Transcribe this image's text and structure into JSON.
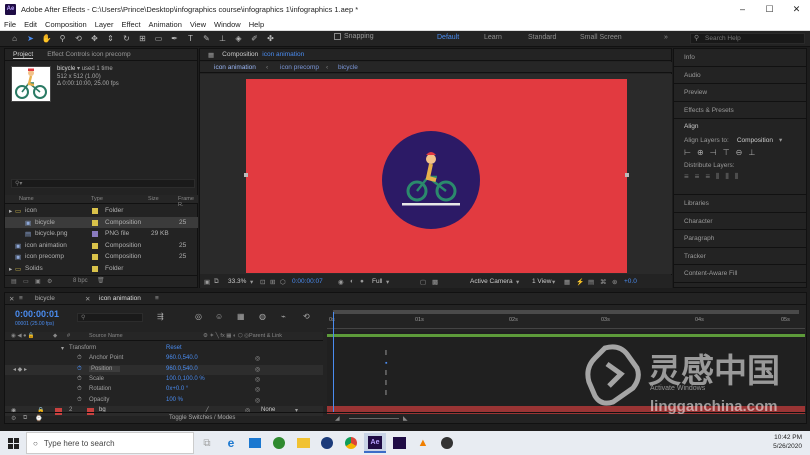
{
  "window": {
    "title": "Adobe After Effects - C:\\Users\\Prince\\Desktop\\infographics course\\infographics 1\\infographics 1.aep *",
    "app_abbr": "Ae"
  },
  "menu": [
    "File",
    "Edit",
    "Composition",
    "Layer",
    "Effect",
    "Animation",
    "View",
    "Window",
    "Help"
  ],
  "toolbar": {
    "snapping": "Snapping",
    "workspaces": [
      "Default",
      "Learn",
      "Standard",
      "Small Screen"
    ],
    "search_placeholder": "Search Help"
  },
  "project": {
    "tabs": [
      "Project",
      "Effect Controls icon precomp"
    ],
    "selected": {
      "name": "bicycle",
      "used": "used 1 time",
      "dims": "512 x 512 (1.00)",
      "duration": "Δ 0:00:10:00, 25.00 fps"
    },
    "columns": [
      "Name",
      "Type",
      "Size",
      "Frame R."
    ],
    "rows": [
      {
        "name": "icon",
        "type": "Folder",
        "size": "",
        "fr": "",
        "indent": 0,
        "color": "#d9c24a"
      },
      {
        "name": "bicycle",
        "type": "Composition",
        "size": "",
        "fr": "25",
        "indent": 1,
        "color": "#d9c24a"
      },
      {
        "name": "bicycle.png",
        "type": "PNG file",
        "size": "29 KB",
        "fr": "",
        "indent": 1,
        "color": "#8a7bbf"
      },
      {
        "name": "icon animation",
        "type": "Composition",
        "size": "",
        "fr": "25",
        "indent": 0,
        "color": "#d9c24a"
      },
      {
        "name": "icon precomp",
        "type": "Composition",
        "size": "",
        "fr": "25",
        "indent": 0,
        "color": "#d9c24a"
      },
      {
        "name": "Solids",
        "type": "Folder",
        "size": "",
        "fr": "",
        "indent": 0,
        "color": "#d9c24a"
      }
    ],
    "footer_bpc": "8 bpc"
  },
  "comp": {
    "tab": "Composition",
    "tab_name": "icon animation",
    "breadcrumbs": [
      "icon animation",
      "icon precomp",
      "bicycle"
    ],
    "zoom": "33.3%",
    "timecode": "0:00:00:07",
    "resolution": "Full",
    "camera": "Active Camera",
    "views": "1 View",
    "exposure": "+0.0"
  },
  "right_panel": {
    "items": [
      "Info",
      "Audio",
      "Preview",
      "Effects & Presets"
    ],
    "align_title": "Align",
    "align_layers_to": "Align Layers to:",
    "align_target": "Composition",
    "distribute": "Distribute Layers:",
    "items2": [
      "Libraries",
      "Character",
      "Paragraph",
      "Tracker",
      "Content-Aware Fill"
    ]
  },
  "timeline": {
    "tabs": [
      "bicycle",
      "icon animation"
    ],
    "timecode": "0:00:00:01",
    "timecode_sub": "00001 (25.00 fps)",
    "columns": [
      "Source Name",
      "Parent & Link"
    ],
    "ruler": [
      "0s",
      "01s",
      "02s",
      "03s",
      "04s",
      "05s"
    ],
    "rows": [
      {
        "label": "Transform",
        "value": "Reset",
        "indent": 1
      },
      {
        "label": "Anchor Point",
        "value": "960.0,540.0",
        "indent": 2
      },
      {
        "label": "Position",
        "value": "960.0,540.0",
        "indent": 2
      },
      {
        "label": "Scale",
        "value": "100.0,100.0 %",
        "indent": 2
      },
      {
        "label": "Rotation",
        "value": "0x+0.0 °",
        "indent": 2
      },
      {
        "label": "Opacity",
        "value": "100 %",
        "indent": 2
      }
    ],
    "layer": {
      "num": "2",
      "name": "bg",
      "parent": "None"
    },
    "toggle": "Toggle Switches / Modes"
  },
  "taskbar": {
    "search": "Type here to search",
    "time": "10:42 PM",
    "date": "5/26/2020"
  },
  "watermark": {
    "big": "灵感中国",
    "url": "lingganchina.com",
    "activate": "Activate Windows"
  }
}
